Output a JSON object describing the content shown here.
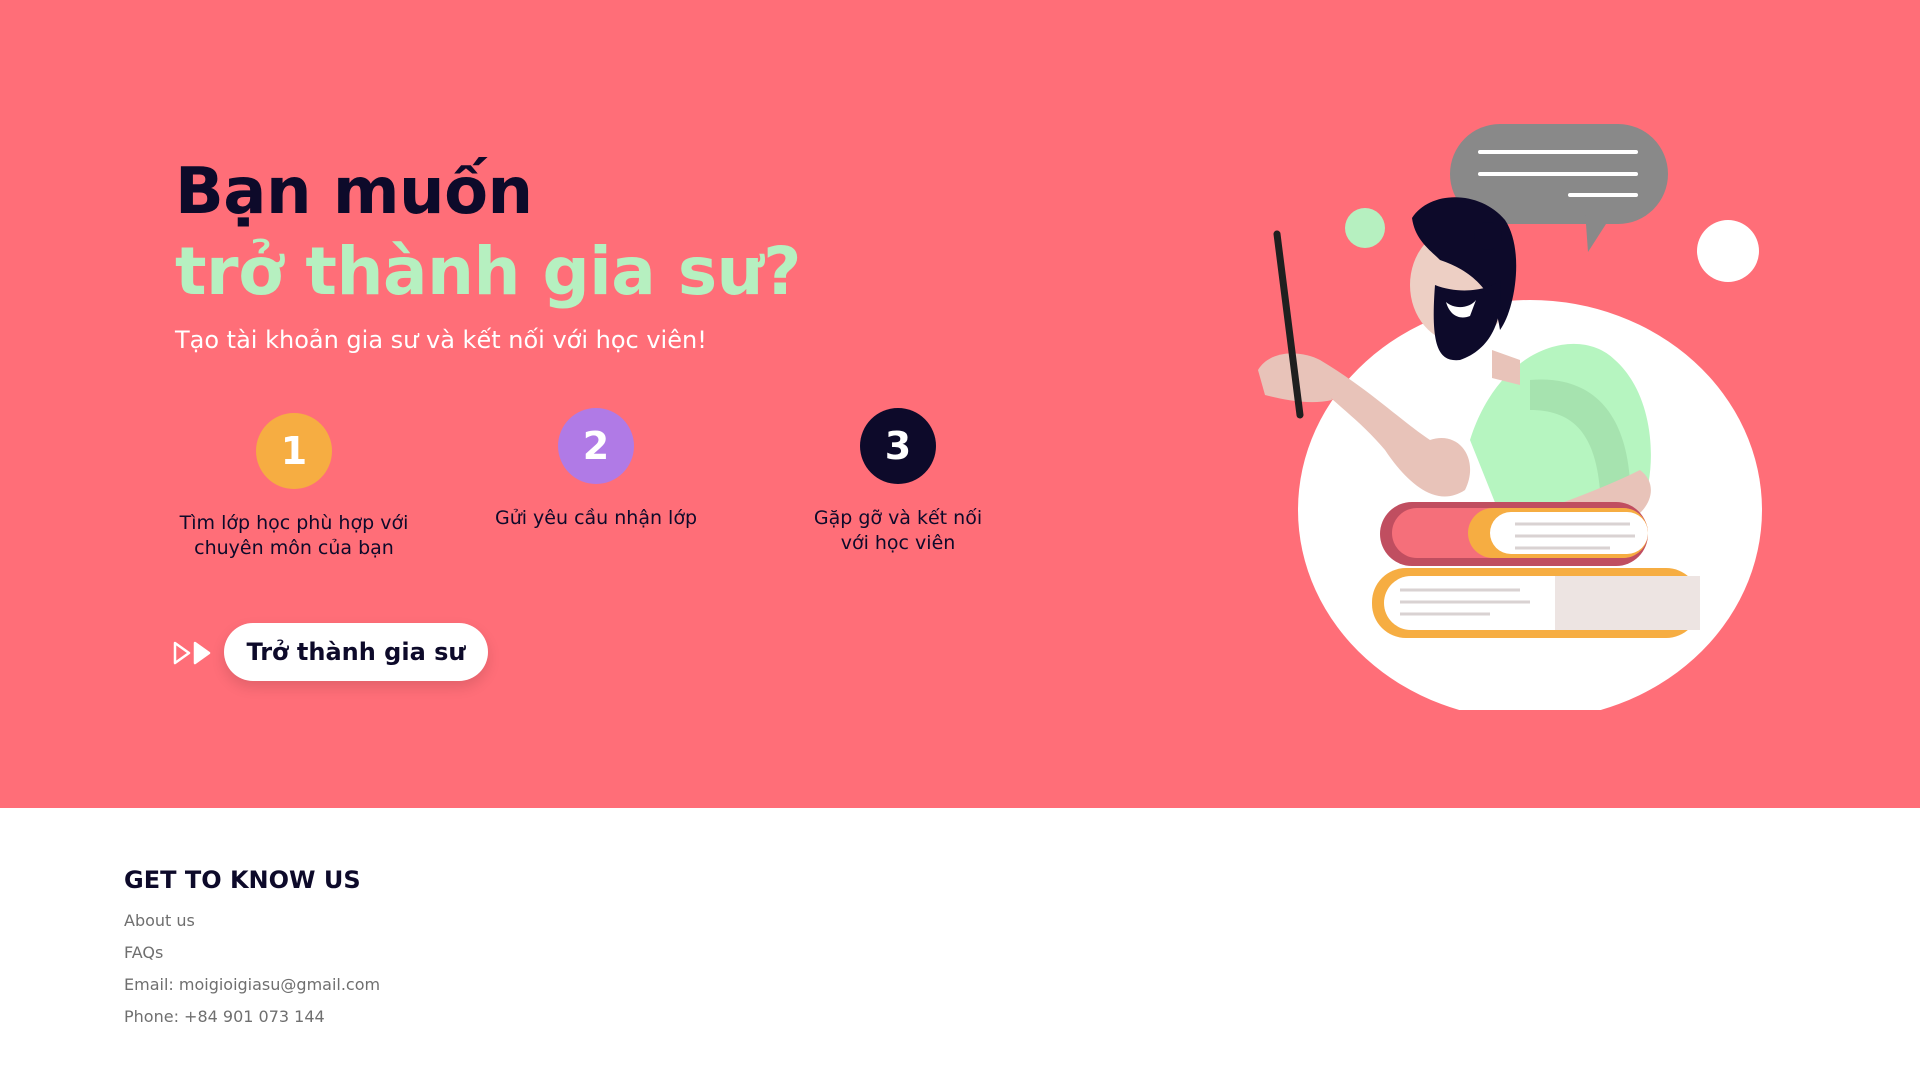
{
  "hero": {
    "headline_line1": "Bạn muốn",
    "headline_line2": "trở thành gia sư?",
    "subtitle": "Tạo tài khoản gia sư và kết nối với học viên!",
    "steps": [
      {
        "number": "1",
        "label_line1": "Tìm lớp học phù hợp với",
        "label_line2": "chuyên môn của bạn"
      },
      {
        "number": "2",
        "label_line1": "Gửi yêu cầu nhận lớp",
        "label_line2": ""
      },
      {
        "number": "3",
        "label_line1": "Gặp gỡ và kết nối",
        "label_line2": "với học viên"
      }
    ],
    "cta_label": "Trở thành gia sư"
  },
  "footer": {
    "title": "GET TO KNOW US",
    "links": {
      "about": "About us",
      "faqs": "FAQs",
      "email": "Email: moigioigiasu@gmail.com",
      "phone": "Phone: +84 901 073 144"
    }
  },
  "colors": {
    "hero_background": "#FF6E78",
    "headline_dark": "#0d0a2a",
    "headline_accent": "#B6F0C0",
    "step1": "#F6AD42",
    "step2": "#B07AE6",
    "step3": "#0d0a2a"
  },
  "icons": {
    "cta_arrows": "double-play-arrow-icon",
    "illustration": "teacher-with-pointer-illustration"
  }
}
